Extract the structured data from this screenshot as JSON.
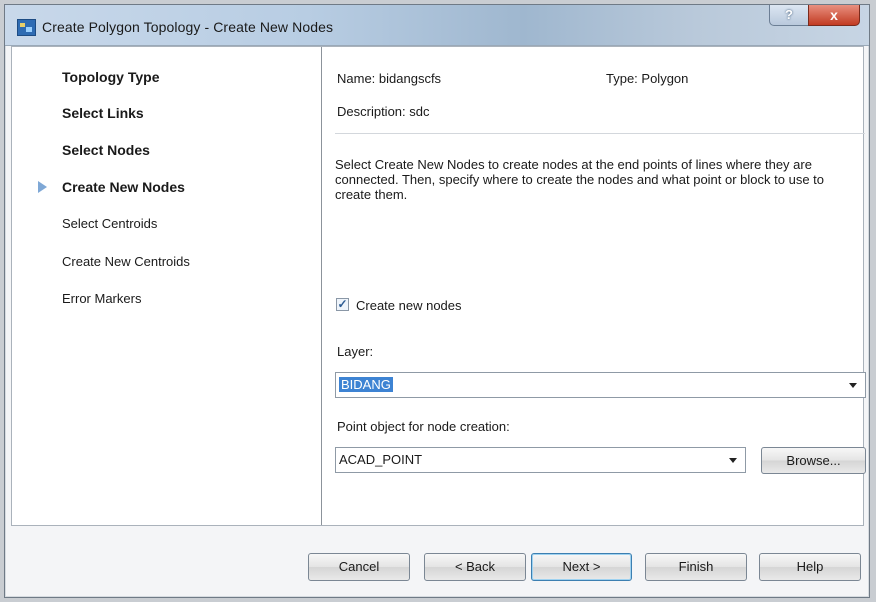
{
  "window": {
    "title": "Create Polygon Topology - Create New Nodes",
    "help_label": "?",
    "close_label": "x"
  },
  "nav": {
    "items": [
      {
        "label": "Topology Type",
        "bold": true
      },
      {
        "label": "Select Links",
        "bold": true
      },
      {
        "label": "Select Nodes",
        "bold": true
      },
      {
        "label": "Create New Nodes",
        "bold": true,
        "current": true
      },
      {
        "label": "Select Centroids",
        "bold": false
      },
      {
        "label": "Create New Centroids",
        "bold": false
      },
      {
        "label": "Error Markers",
        "bold": false
      }
    ]
  },
  "info": {
    "name": "Name: bidangscfs",
    "type": "Type: Polygon",
    "description": "Description: sdc"
  },
  "instructions": "Select Create New Nodes to create nodes at the end points of lines where they are connected. Then, specify where to create the nodes and what point or block to use to create them.",
  "create_nodes": {
    "label": "Create new nodes",
    "checked": true,
    "check_glyph": "✓"
  },
  "layer": {
    "label": "Layer:",
    "value": "BIDANG"
  },
  "point_object": {
    "label": "Point object for node creation:",
    "value": "ACAD_POINT"
  },
  "buttons": {
    "browse": "Browse...",
    "cancel": "Cancel",
    "back": "< Back",
    "next": "Next >",
    "finish": "Finish",
    "help": "Help"
  }
}
